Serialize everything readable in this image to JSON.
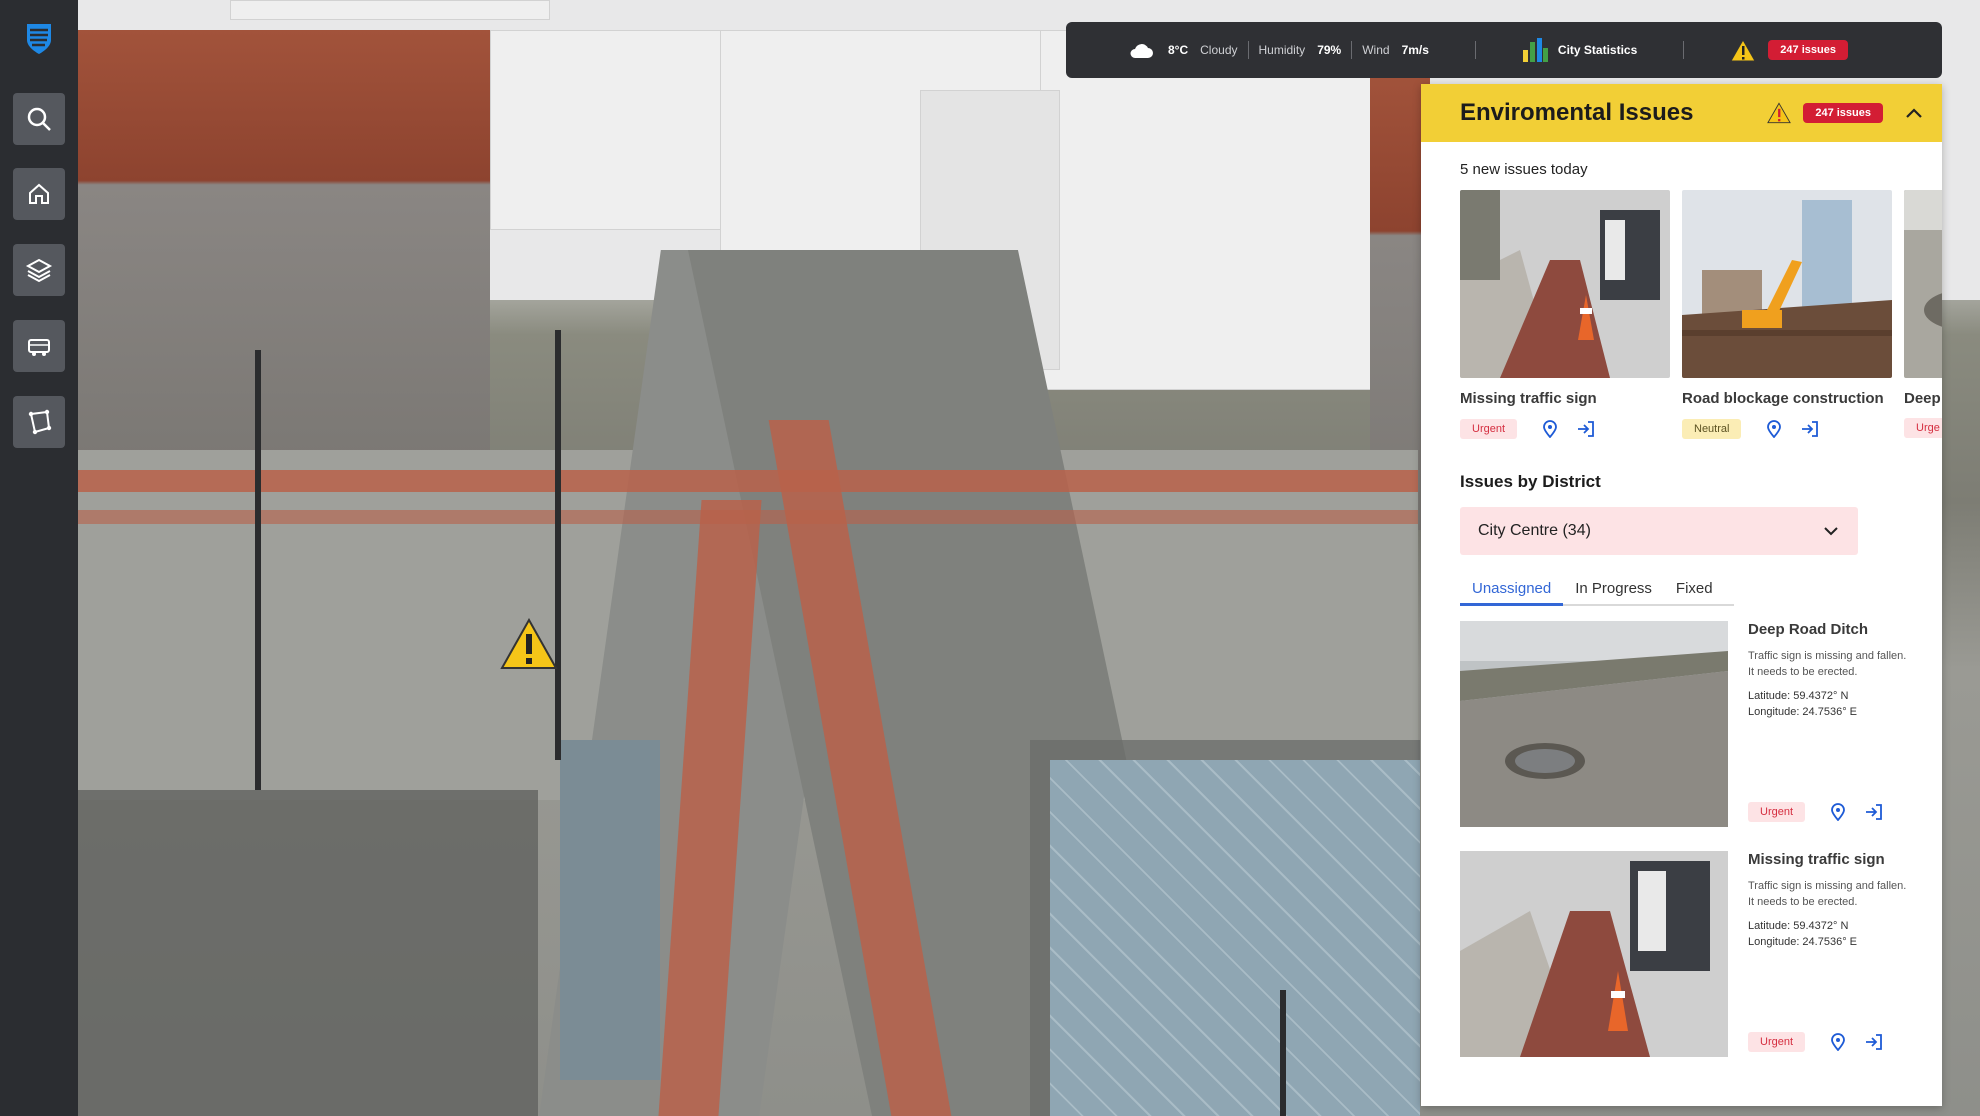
{
  "app": {
    "brand_icon": "shield-stripes-logo"
  },
  "sidebar": {
    "items": [
      {
        "name": "search",
        "icon": "search-icon"
      },
      {
        "name": "home",
        "icon": "home-icon"
      },
      {
        "name": "layers",
        "icon": "layers-icon"
      },
      {
        "name": "transport",
        "icon": "bus-icon"
      },
      {
        "name": "area",
        "icon": "polygon-tool-icon"
      }
    ]
  },
  "topbar": {
    "temperature": "8°C",
    "condition": "Cloudy",
    "humidity_label": "Humidity",
    "humidity_value": "79%",
    "wind_label": "Wind",
    "wind_value": "7m/s",
    "stats_label": "City Statistics",
    "issues_badge": "247 issues"
  },
  "panel": {
    "title": "Enviromental Issues",
    "issues_badge": "247 issues",
    "new_today": "5 new issues today",
    "cards": [
      {
        "title": "Missing traffic sign",
        "status": "Urgent"
      },
      {
        "title": "Road blockage construction",
        "status": "Neutral"
      },
      {
        "title": "Deep",
        "status": "Urge"
      }
    ],
    "district_section_title": "Issues by District",
    "district_selected": "City Centre (34)",
    "tabs": [
      "Unassigned",
      "In Progress",
      "Fixed"
    ],
    "issues": [
      {
        "title": "Deep Road Ditch",
        "description": "Traffic sign is missing and fallen. It needs to be erected.",
        "latitude": "Latitude: 59.4372° N",
        "longitude": "Longitude: 24.7536° E",
        "status": "Urgent"
      },
      {
        "title": "Missing traffic sign",
        "description": "Traffic sign is missing and fallen. It needs to be erected.",
        "latitude": "Latitude: 59.4372° N",
        "longitude": "Longitude: 24.7536° E",
        "status": "Urgent"
      }
    ]
  },
  "colors": {
    "accent_yellow": "#f2cf36",
    "urgent_red": "#d31d34",
    "tab_blue": "#3367d6",
    "sidebar_bg": "#2b2d31"
  }
}
